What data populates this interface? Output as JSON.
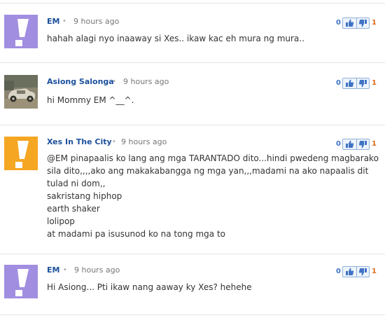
{
  "comments": [
    {
      "author": "EM",
      "separator": "•",
      "time": "9 hours ago",
      "avatar_icon": "exclamation-avatar",
      "avatar_color": "#a18ee0",
      "votes_up": "0",
      "votes_down": "1",
      "lines": [
        "hahah alagi nyo inaaway si Xes.. ikaw kac eh mura ng mura.."
      ]
    },
    {
      "author": "Asiong Salonga",
      "separator": "•",
      "time": "9 hours ago",
      "avatar_icon": "vintage-car-photo",
      "votes_up": "0",
      "votes_down": "1",
      "lines": [
        "hi Mommy EM ^__^."
      ]
    },
    {
      "author": "Xes In The City",
      "separator": "•",
      "time": "9 hours ago",
      "avatar_icon": "exclamation-avatar",
      "avatar_color": "#f5a623",
      "votes_up": "0",
      "votes_down": "1",
      "lines": [
        "@EM pinapaalis ko lang ang mga TARANTADO dito...hindi pwedeng magbarako",
        "sila dito,,,,ako ang makakabangga ng mga yan,,,madami na ako napaalis dit",
        "tulad ni dom,,",
        "sakristang hiphop",
        "earth shaker",
        "lolipop",
        "at madami pa isusunod ko na tong mga to"
      ]
    },
    {
      "author": "EM",
      "separator": "•",
      "time": "9 hours ago",
      "avatar_icon": "exclamation-avatar",
      "avatar_color": "#a18ee0",
      "votes_up": "0",
      "votes_down": "1",
      "lines": [
        "Hi Asiong... Pti ikaw nang aaway ky Xes? hehehe"
      ]
    }
  ],
  "icons": {
    "thumbs_up": "thumbs-up-icon",
    "thumbs_down": "thumbs-down-icon"
  }
}
